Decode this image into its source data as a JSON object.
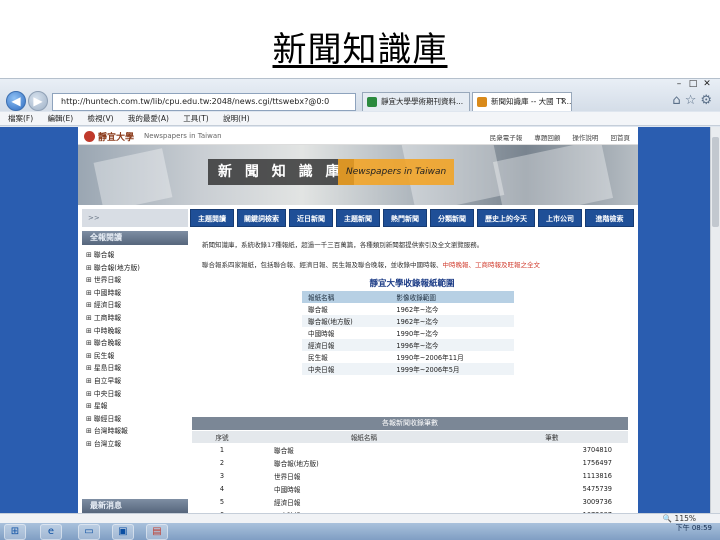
{
  "slide_title": "新聞知識庫",
  "browser": {
    "address": "http://huntech.com.tw/lib/cpu.edu.tw:2048/news.cgi/ttswebx?@0:0",
    "address_controls": "▾ ⌕ ▾ ✕",
    "tabs": [
      {
        "label": "靜宜大學學術期刊資料..."
      },
      {
        "label": "新聞知識庫 -- 大國 TT..."
      }
    ],
    "menu": [
      "檔案(F)",
      "編輯(E)",
      "檢視(V)",
      "我的最愛(A)",
      "工具(T)",
      "說明(H)"
    ],
    "zoom": "🔍 115%"
  },
  "site": {
    "logo": "靜宜大學",
    "logo_en": "Newspapers in Taiwan",
    "top_links": [
      "民衆電子報",
      "專題回顧",
      "操作說明",
      "回首頁"
    ],
    "banner_title": "新 聞 知 識 庫",
    "banner_title_en": "Newspapers in Taiwan",
    "nav": [
      "主題閱讀",
      "關鍵詞檢索",
      "近日新聞",
      "主題新聞",
      "熱門新聞",
      "分類新聞",
      "歷史上的今天",
      "上市公司",
      "進階檢索"
    ],
    "left_strip": ">>",
    "tree_heading": "全報閱讀",
    "tree_items": [
      "聯合報",
      "聯合報(地方版)",
      "世界日報",
      "中國時報",
      "經濟日報",
      "工商時報",
      "中時晚報",
      "聯合晚報",
      "民生報",
      "星島日報",
      "自立早報",
      "中央日報",
      "星報",
      "聯經日報",
      "台灣時報報",
      "台灣立報"
    ],
    "news_heading": "最新消息",
    "intro_line_1": "新聞知識庫，系統收錄17種報紙，超過一千三百萬篇，各種類別新聞都提供索引及全文瀏覽服務。",
    "intro_line_2_a": "聯合報系四家報紙，包括聯合報、經濟日報、民生報及聯合晚報，並收錄中國時報、",
    "intro_line_2_b": "中時晚報、工商時報及旺報之全文",
    "collection_title": "靜宜大學收錄報紙範圍",
    "range_headers": [
      "報紙名稱",
      "影像收錄範圍"
    ],
    "range_rows": [
      [
        "聯合報",
        "1962年~迄今"
      ],
      [
        "聯合報(地方版)",
        "1962年~迄今"
      ],
      [
        "中國時報",
        "1990年~迄今"
      ],
      [
        "經濟日報",
        "1996年~迄今"
      ],
      [
        "民生報",
        "1990年~2006年11月"
      ],
      [
        "中央日報",
        "1999年~2006年5月"
      ]
    ],
    "stats_title": "各報新聞收錄筆數",
    "stats_headers": [
      "序號",
      "報紙名稱",
      "筆數"
    ],
    "stats_rows": [
      [
        "1",
        "聯合報",
        "3704810"
      ],
      [
        "2",
        "聯合報(地方版)",
        "1756497"
      ],
      [
        "3",
        "世界日報",
        "1113816"
      ],
      [
        "4",
        "中國時報",
        "5475739"
      ],
      [
        "5",
        "經濟日報",
        "3009736"
      ],
      [
        "6",
        "工商時報",
        "1072687"
      ]
    ]
  },
  "taskbar": {
    "clock": "下午 08:59"
  },
  "colors": {
    "browser_background": "#2a5db0",
    "nav_button": "#1f4f97",
    "section_header": "#56667c",
    "highlight": "#d03a2c"
  }
}
